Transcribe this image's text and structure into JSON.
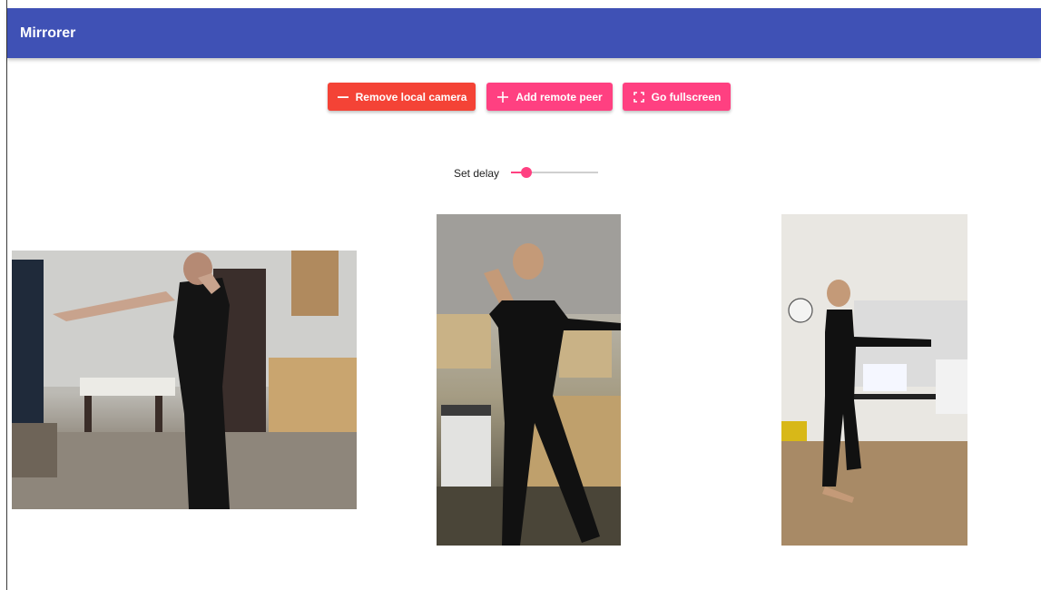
{
  "app": {
    "title": "Mirrorer"
  },
  "toolbar": {
    "remove_camera_label": "Remove local camera",
    "add_peer_label": "Add remote peer",
    "fullscreen_label": "Go fullscreen"
  },
  "delay": {
    "label": "Set delay",
    "value_fraction": 0.18
  },
  "colors": {
    "appbar": "#3f51b5",
    "warn": "#f44336",
    "accent": "#ff4081"
  },
  "icons": {
    "remove": "minus-icon",
    "add": "plus-icon",
    "fullscreen": "fullscreen-icon"
  }
}
